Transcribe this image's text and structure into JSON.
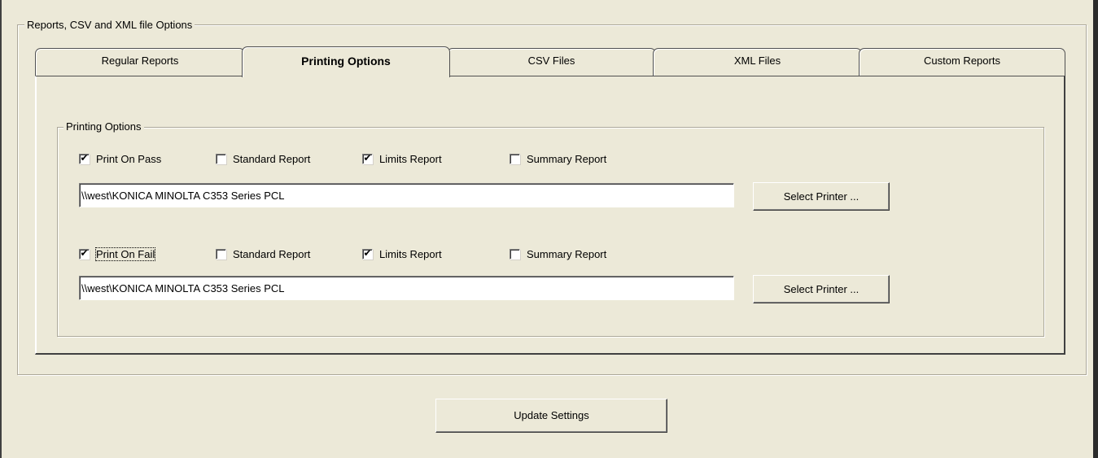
{
  "outer_group": {
    "title": "Reports, CSV and XML file Options"
  },
  "tabs": [
    {
      "label": "Regular Reports",
      "active": false
    },
    {
      "label": "Printing Options",
      "active": true
    },
    {
      "label": "CSV Files",
      "active": false
    },
    {
      "label": "XML Files",
      "active": false
    },
    {
      "label": "Custom Reports",
      "active": false
    }
  ],
  "printing_group": {
    "title": "Printing Options"
  },
  "pass_section": {
    "print_on_label": "Print On Pass",
    "print_on_checked": true,
    "standard_report_label": "Standard Report",
    "standard_report_checked": false,
    "limits_report_label": "Limits Report",
    "limits_report_checked": true,
    "summary_report_label": "Summary Report",
    "summary_report_checked": false,
    "printer_value": "\\\\west\\KONICA MINOLTA C353 Series PCL",
    "select_printer_label": "Select Printer ..."
  },
  "fail_section": {
    "print_on_label": "Print On Fail",
    "print_on_checked": true,
    "standard_report_label": "Standard Report",
    "standard_report_checked": false,
    "limits_report_label": "Limits Report",
    "limits_report_checked": true,
    "summary_report_label": "Summary Report",
    "summary_report_checked": false,
    "printer_value": "\\\\west\\KONICA MINOLTA C353 Series PCL",
    "select_printer_label": "Select Printer ..."
  },
  "update_button": {
    "label": "Update Settings"
  },
  "icons": {
    "checkmark": "checkmark-icon"
  }
}
